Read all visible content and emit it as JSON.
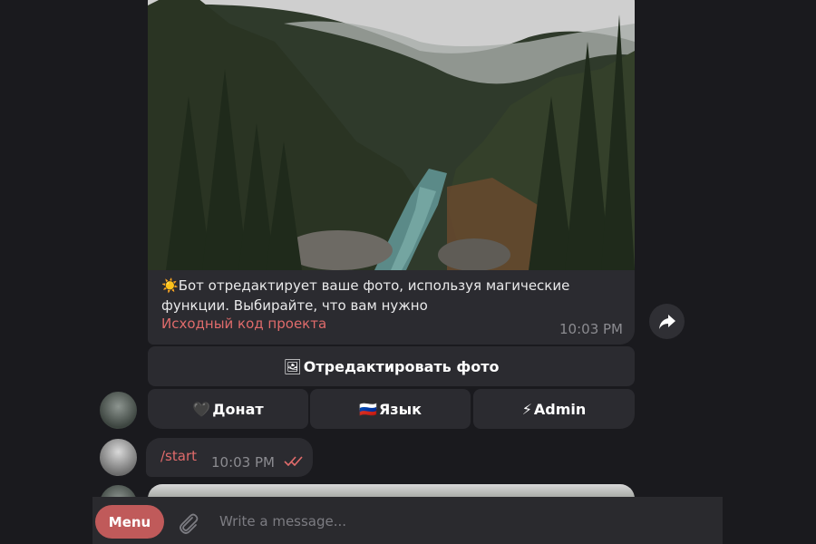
{
  "message": {
    "caption_line1": "Бот отредактирует ваше фото, используя магические",
    "caption_line2": "функции. Выбирайте, что вам нужно",
    "caption_emoji": "☀️",
    "source_link": "Исходный код проекта",
    "time": "10:03 PM"
  },
  "keyboard": {
    "edit": {
      "emoji": "🖼",
      "label": "Отредактировать фото"
    },
    "donate": {
      "emoji": "🖤",
      "label": "Донат"
    },
    "language": {
      "emoji": "🇷🇺",
      "label": "Язык"
    },
    "admin": {
      "emoji": "⚡",
      "label": "Admin"
    }
  },
  "user_message": {
    "text": "/start",
    "time": "10:03 PM"
  },
  "composer": {
    "menu_label": "Menu",
    "placeholder": "Write a message..."
  },
  "icons": {
    "forward": "share-arrow-icon",
    "attach": "paperclip-icon",
    "read": "double-check-icon"
  },
  "colors": {
    "background": "#1a1a1e",
    "bubble": "#2b2b30",
    "accent": "#c05a5a",
    "link": "#e06b6b"
  }
}
